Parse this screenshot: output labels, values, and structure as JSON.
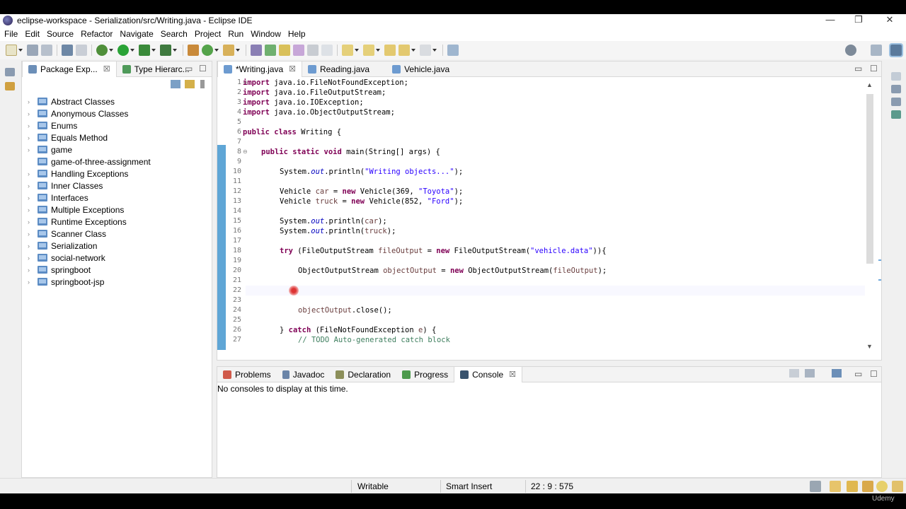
{
  "window": {
    "title": "eclipse-workspace - Serialization/src/Writing.java - Eclipse IDE",
    "controls": {
      "minimize": "—",
      "restore": "❐",
      "close": "✕"
    }
  },
  "menu": [
    "File",
    "Edit",
    "Source",
    "Refactor",
    "Navigate",
    "Search",
    "Project",
    "Run",
    "Window",
    "Help"
  ],
  "package_explorer": {
    "tabs": [
      {
        "label": "Package Exp...",
        "close": "☒"
      },
      {
        "label": "Type Hierarc..."
      }
    ],
    "items": [
      {
        "label": "Abstract Classes",
        "expandable": "›"
      },
      {
        "label": "Anonymous Classes",
        "expandable": "›"
      },
      {
        "label": "Enums",
        "expandable": "›"
      },
      {
        "label": "Equals Method",
        "expandable": "›"
      },
      {
        "label": "game",
        "expandable": "›"
      },
      {
        "label": "game-of-three-assignment",
        "expandable": ""
      },
      {
        "label": "Handling Exceptions",
        "expandable": "›"
      },
      {
        "label": "Inner Classes",
        "expandable": "›"
      },
      {
        "label": "Interfaces",
        "expandable": "›"
      },
      {
        "label": "Multiple Exceptions",
        "expandable": "›"
      },
      {
        "label": "Runtime Exceptions",
        "expandable": "›"
      },
      {
        "label": "Scanner Class",
        "expandable": "›"
      },
      {
        "label": "Serialization",
        "expandable": "›"
      },
      {
        "label": "social-network",
        "expandable": "›"
      },
      {
        "label": "springboot",
        "expandable": "›"
      },
      {
        "label": "springboot-jsp",
        "expandable": "›"
      }
    ]
  },
  "editor": {
    "tabs": [
      {
        "label": "*Writing.java",
        "close": "☒"
      },
      {
        "label": "Reading.java"
      },
      {
        "label": "Vehicle.java"
      }
    ],
    "line_numbers": [
      "1",
      "2",
      "3",
      "4",
      "5",
      "6",
      "7",
      "8",
      "9",
      "10",
      "11",
      "12",
      "13",
      "14",
      "15",
      "16",
      "17",
      "18",
      "19",
      "20",
      "21",
      "22",
      "23",
      "24",
      "25",
      "26",
      "27"
    ]
  },
  "console": {
    "tabs": [
      {
        "label": "Problems"
      },
      {
        "label": "Javadoc"
      },
      {
        "label": "Declaration"
      },
      {
        "label": "Progress"
      },
      {
        "label": "Console",
        "close": "☒"
      }
    ],
    "message": "No consoles to display at this time."
  },
  "status": {
    "writable": "Writable",
    "insert_mode": "Smart Insert",
    "position": "22 : 9 : 575"
  },
  "watermark": "Udemy",
  "colors": {
    "keyword": "#7f0055",
    "string": "#2a00ff",
    "static_field": "#0000c0",
    "comment": "#3f7f5f",
    "gutter_marker": "#5fa6d6"
  }
}
